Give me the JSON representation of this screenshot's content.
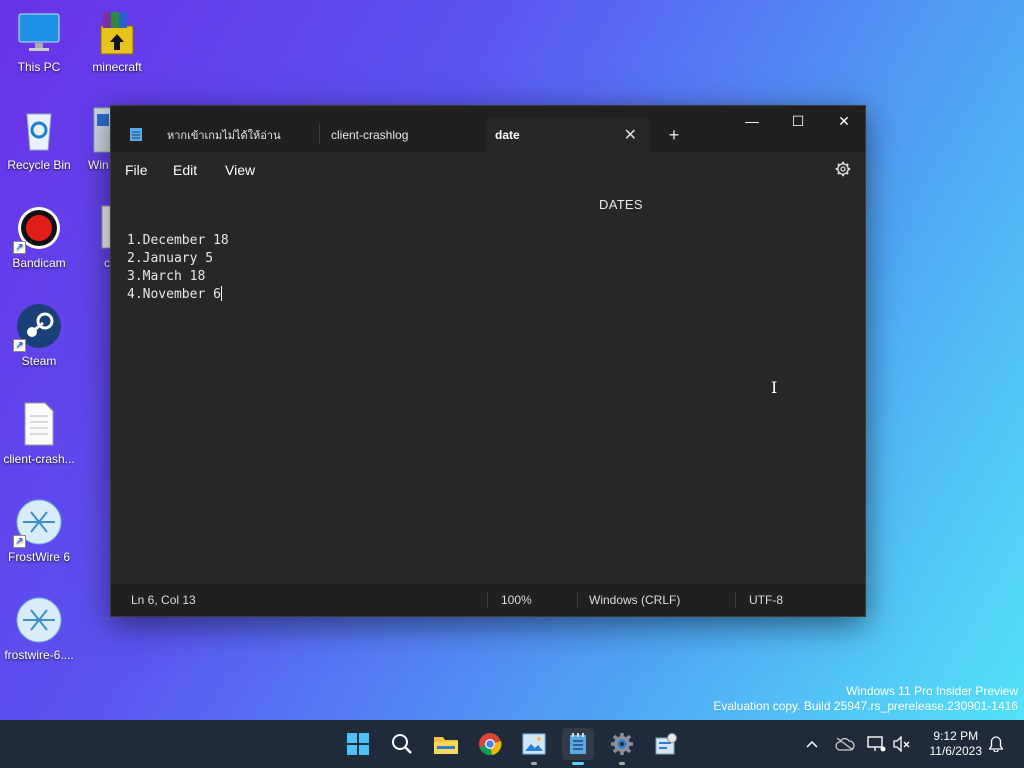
{
  "desktop": {
    "icons": [
      {
        "label": "This PC"
      },
      {
        "label": "minecraft"
      },
      {
        "label": "Recycle Bin"
      },
      {
        "label": "Win"
      },
      {
        "label": "Bandicam"
      },
      {
        "label": "c"
      },
      {
        "label": "Steam"
      },
      {
        "label": "client-crash..."
      },
      {
        "label": "FrostWire 6"
      },
      {
        "label": "frostwire-6...."
      }
    ]
  },
  "notepad": {
    "tabs": [
      {
        "label": "หากเข้าเกมไม่ได้ให้อ่าน",
        "icon": "notepad-icon"
      },
      {
        "label": "client-crashlog"
      },
      {
        "label": "date",
        "active": true,
        "close": "✕"
      }
    ],
    "new_tab": "+",
    "window_controls": {
      "minimize": "—",
      "maximize": "☐",
      "close": "✕"
    },
    "menu": {
      "file": "File",
      "edit": "Edit",
      "view": "View",
      "settings_icon": "gear-icon"
    },
    "content": {
      "heading": "DATES",
      "lines": [
        "1.December 18",
        "2.January 5",
        "3.March 18",
        "4.November 6"
      ]
    },
    "status": {
      "position": "Ln 6, Col 13",
      "zoom": "100%",
      "line_ending": "Windows (CRLF)",
      "encoding": "UTF-8"
    }
  },
  "watermark": {
    "line1": "Windows 11 Pro Insider Preview",
    "line2": "Evaluation copy. Build 25947.rs_prerelease.230901-1416"
  },
  "taskbar": {
    "apps": [
      "start-icon",
      "search-icon",
      "file-explorer-icon",
      "chrome-icon",
      "photos-icon",
      "notepad-icon",
      "settings-icon",
      "control-panel-icon"
    ],
    "clock": {
      "time": "9:12 PM",
      "date": "11/6/2023"
    },
    "tray": [
      "chevron-up-icon",
      "cloud-icon",
      "network-icon",
      "volume-muted-icon",
      "notification-bell-icon"
    ]
  },
  "colors": {
    "accent": "#60cdff",
    "window_bg": "#272727",
    "titlebar_bg": "#202020"
  }
}
